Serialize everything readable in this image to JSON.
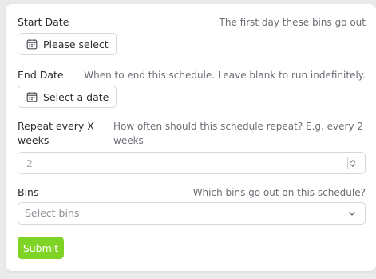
{
  "start_date": {
    "label": "Start Date",
    "help": "The first day these bins go out",
    "button_label": "Please select"
  },
  "end_date": {
    "label": "End Date",
    "help": "When to end this schedule. Leave blank to run indefinitely.",
    "button_label": "Select a date"
  },
  "repeat": {
    "label_line1": "Repeat every X",
    "label_line2": "weeks",
    "help_line1": "How often should this schedule repeat? E.g. every 2",
    "help_line2": "weeks",
    "placeholder": "2"
  },
  "bins": {
    "label": "Bins",
    "help": "Which bins go out on this schedule?",
    "placeholder": "Select bins"
  },
  "submit_label": "Submit",
  "icons": {
    "calendar": "calendar-icon",
    "stepper": "stepper-icon",
    "chevron": "chevron-down-icon"
  },
  "colors": {
    "submit_bg": "#7fd325",
    "border": "#d3d6db",
    "help_text": "#6b6f76"
  }
}
